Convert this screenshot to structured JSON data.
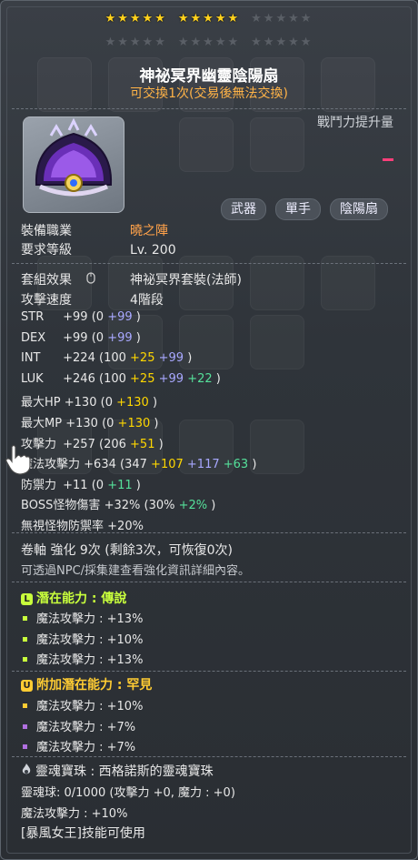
{
  "stars": {
    "row1_filled": 10,
    "row1_empty": 5,
    "row2_empty": 15,
    "star_char": "★"
  },
  "item": {
    "name": "神祕冥界幽靈陰陽扇",
    "trade_note": "可交換1次(交易後無法交換)",
    "power_label": "戰鬥力提升量",
    "tags": [
      "武器",
      "單手",
      "陰陽扇"
    ]
  },
  "req": {
    "job_label": "裝備職業",
    "job_value": "曉之陣",
    "level_label": "要求等級",
    "level_value": "Lv. 200"
  },
  "set": {
    "label": "套組效果",
    "value": "神祕冥界套裝(法師)"
  },
  "speed": {
    "label": "攻擊速度",
    "value": "4階段"
  },
  "stats": [
    {
      "name": "STR",
      "total": "+99",
      "open": "(0",
      "parts": [
        [
          "+99",
          "blue"
        ]
      ],
      "close": ")"
    },
    {
      "name": "DEX",
      "total": "+99",
      "open": "(0",
      "parts": [
        [
          "+99",
          "blue"
        ]
      ],
      "close": ")"
    },
    {
      "name": "INT",
      "total": "+224",
      "open": "(100",
      "parts": [
        [
          "+25",
          "yellow"
        ],
        [
          "+99",
          "blue"
        ]
      ],
      "close": ")"
    },
    {
      "name": "LUK",
      "total": "+246",
      "open": "(100",
      "parts": [
        [
          "+25",
          "yellow"
        ],
        [
          "+99",
          "blue"
        ],
        [
          "+22",
          "green"
        ]
      ],
      "close": ")"
    },
    {
      "name": "最大HP",
      "total": "+130",
      "open": "(0",
      "parts": [
        [
          "+130",
          "yellow"
        ]
      ],
      "close": ")"
    },
    {
      "name": "最大MP",
      "total": "+130",
      "open": "(0",
      "parts": [
        [
          "+130",
          "yellow"
        ]
      ],
      "close": ")"
    },
    {
      "name": "攻擊力",
      "total": "+257",
      "open": "(206",
      "parts": [
        [
          "+51",
          "yellow"
        ]
      ],
      "close": ")"
    },
    {
      "name": "魔法攻擊力",
      "total": "+634",
      "open": "(347",
      "parts": [
        [
          "+107",
          "yellow"
        ],
        [
          "+117",
          "blue"
        ],
        [
          "+63",
          "green"
        ]
      ],
      "close": ")"
    },
    {
      "name": "防禦力",
      "total": "+11",
      "open": "(0",
      "parts": [
        [
          "+11",
          "green"
        ]
      ],
      "close": ")"
    },
    {
      "name": "BOSS怪物傷害",
      "total": "+32%",
      "open": "(30%",
      "parts": [
        [
          "+2%",
          "green"
        ]
      ],
      "close": ")"
    },
    {
      "name": "無視怪物防禦率",
      "total": "+20%",
      "open": "",
      "parts": [],
      "close": ""
    }
  ],
  "scroll": {
    "line": "卷軸 強化 9次 (剩餘3次，可恢復0次)",
    "hint": "可透過NPC/採集建查看強化資訊詳細內容。"
  },
  "potential": {
    "badge": "L",
    "header": "潛在能力 : 傳說",
    "color": "#c8ff3c",
    "lines": [
      "魔法攻擊力 : +13%",
      "魔法攻擊力 : +10%",
      "魔法攻擊力 : +13%"
    ],
    "bullet_colors": [
      "#c8ff3c",
      "#c8ff3c",
      "#c8ff3c"
    ]
  },
  "additional": {
    "badge": "U",
    "header": "附加潛在能力 : 罕見",
    "color": "#ffcc33",
    "lines": [
      "魔法攻擊力 : +10%",
      "魔法攻擊力 : +7%",
      "魔法攻擊力 : +7%"
    ],
    "bullet_colors": [
      "#ffcc33",
      "#b070e0",
      "#b070e0"
    ]
  },
  "soul": {
    "line1": "靈魂寶珠 : 西格諾斯的靈魂寶珠",
    "line2": "靈魂球:  0/1000 (攻擊力 +0, 魔力 : +0)",
    "line3": "魔法攻擊力 : +10%",
    "line4": "[暴風女王]技能可使用"
  }
}
